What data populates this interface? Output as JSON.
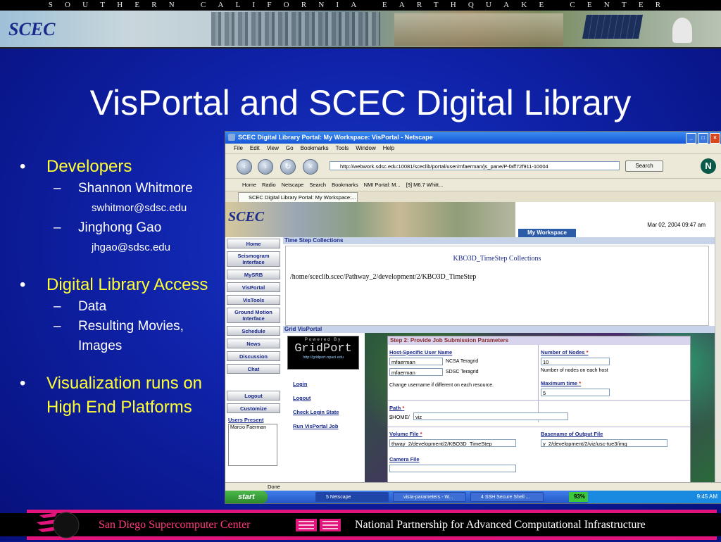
{
  "banner": {
    "text": "SOUTHERN CALIFORNIA EARTHQUAKE CENTER",
    "logo_text": "SCEC"
  },
  "slide": {
    "title": "VisPortal and SCEC Digital Library",
    "bullets": {
      "developers": "Developers",
      "dev1_name": "Shannon Whitmore",
      "dev1_email": "swhitmor@sdsc.edu",
      "dev2_name": "Jinghong Gao",
      "dev2_email": "jhgao@sdsc.edu",
      "access": "Digital Library Access",
      "access_item1": "Data",
      "access_item2": "Resulting Movies, Images",
      "viz": "Visualization runs on High End Platforms"
    }
  },
  "browser": {
    "window_title": "SCEC Digital Library Portal: My Workspace: VisPortal - Netscape",
    "menu": [
      "File",
      "Edit",
      "View",
      "Go",
      "Bookmarks",
      "Tools",
      "Window",
      "Help"
    ],
    "url": "http://webwork.sdsc.edu:10081/sceclib/portal/user/mfaerman/js_pane/P-faff72f911-10004",
    "search_label": "Search",
    "toolbar_items": [
      "Home",
      "Radio",
      "Netscape",
      "Search",
      "Bookmarks",
      "NMI Portal: M...",
      "[9] M6.7 Whitt..."
    ],
    "tab_label": "SCEC Digital Library Portal: My Workspace:...",
    "status": "Done"
  },
  "portal": {
    "logo_text": "SCEC",
    "date": "Mar 02, 2004 09:47 am",
    "workspace_tab": "My Workspace",
    "nav": [
      "Home",
      "Seismogram Interface",
      "MySRB",
      "VisPortal",
      "VisTools",
      "Ground Motion Interface",
      "Schedule",
      "News",
      "Discussion",
      "Chat"
    ],
    "logout": "Logout",
    "customize": "Customize",
    "users_present_label": "Users Present",
    "users_present": "Marcio Faerman",
    "tsc_header": "Time Step Collections",
    "tsc_title": "KBO3D_TimeStep Collections",
    "tsc_path": "/home/sceclib.scec/Pathway_2/development/2/KBO3D_TimeStep",
    "grid_header": "Grid VisPortal",
    "gridport_powered": "Powered By",
    "gridport_name": "GridPort",
    "gridport_url": "http://gridport.npaci.edu",
    "links": [
      "Login",
      "Logout",
      "Check Login State",
      "Run VisPortal Job"
    ],
    "form": {
      "step_title": "Step 2: Provide Job Submission Parameters",
      "host_user_label": "Host-Specific User Name",
      "user1": "mfaerman",
      "host1": "NCSA Teragrid",
      "user2": "mfaerman",
      "host2": "SDSC Teragrid",
      "user_note": "Change username if different on each resource.",
      "nodes_label": "Number of Nodes",
      "nodes_value": "10",
      "nodes_note": "Number of nodes on each host",
      "time_label": "Maximum time",
      "time_value": "5",
      "path_label": "Path",
      "path_prefix": "$HOME/",
      "path_value": "viz",
      "volume_label": "Volume File",
      "volume_value": "thway_2/development/2/KBO3D_TimeStep",
      "basename_label": "Basename of Output File",
      "basename_value": "y_2/development/2/viz/usc-tue3/img_",
      "camera_label": "Camera File",
      "required_mark": "*"
    }
  },
  "taskbar": {
    "start": "start",
    "tasks": [
      "5 Netscape",
      "vista-parameters - W...",
      "4 SSH Secure Shell ..."
    ],
    "percent": "93%",
    "clock": "9:45 AM"
  },
  "footer": {
    "left": "San Diego Supercomputer Center",
    "right": "National Partnership for Advanced Computational Infrastructure"
  },
  "colors": {
    "slide_bg": "#0f22a8",
    "bullet_yellow": "#ffff33",
    "footer_pink": "#e0147a",
    "footer_left_text": "#ff3a7a"
  }
}
